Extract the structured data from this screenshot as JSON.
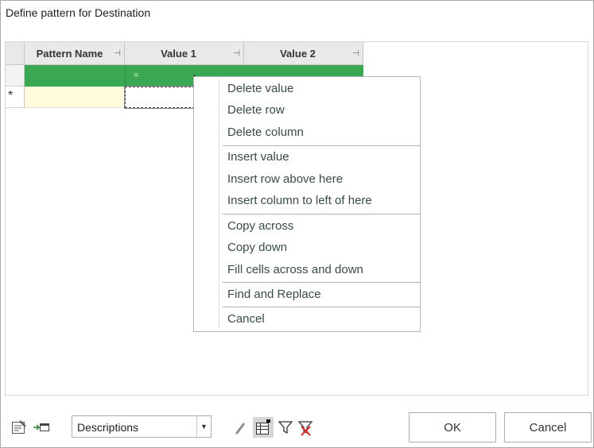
{
  "window": {
    "title": "Define pattern for Destination"
  },
  "grid": {
    "columns": [
      {
        "label": "Pattern Name"
      },
      {
        "label": "Value 1"
      },
      {
        "label": "Value 2"
      }
    ],
    "filter_row": {
      "value1": "="
    }
  },
  "context_menu": {
    "items": [
      "Delete value",
      "Delete row",
      "Delete column",
      "Insert value",
      "Insert row above here",
      "Insert column to left of here",
      "Copy across",
      "Copy down",
      "Fill cells across and down",
      "Find and Replace",
      "Cancel"
    ]
  },
  "toolbar": {
    "view_select": "Descriptions",
    "icons": [
      "properties-icon",
      "move-to-window-icon",
      "pencil-icon",
      "grid-layout-icon",
      "filter-icon",
      "clear-filter-icon"
    ]
  },
  "buttons": {
    "ok": "OK",
    "cancel": "Cancel"
  },
  "colors": {
    "filter_row": "#3aa853",
    "new_row": "#fffddd"
  }
}
